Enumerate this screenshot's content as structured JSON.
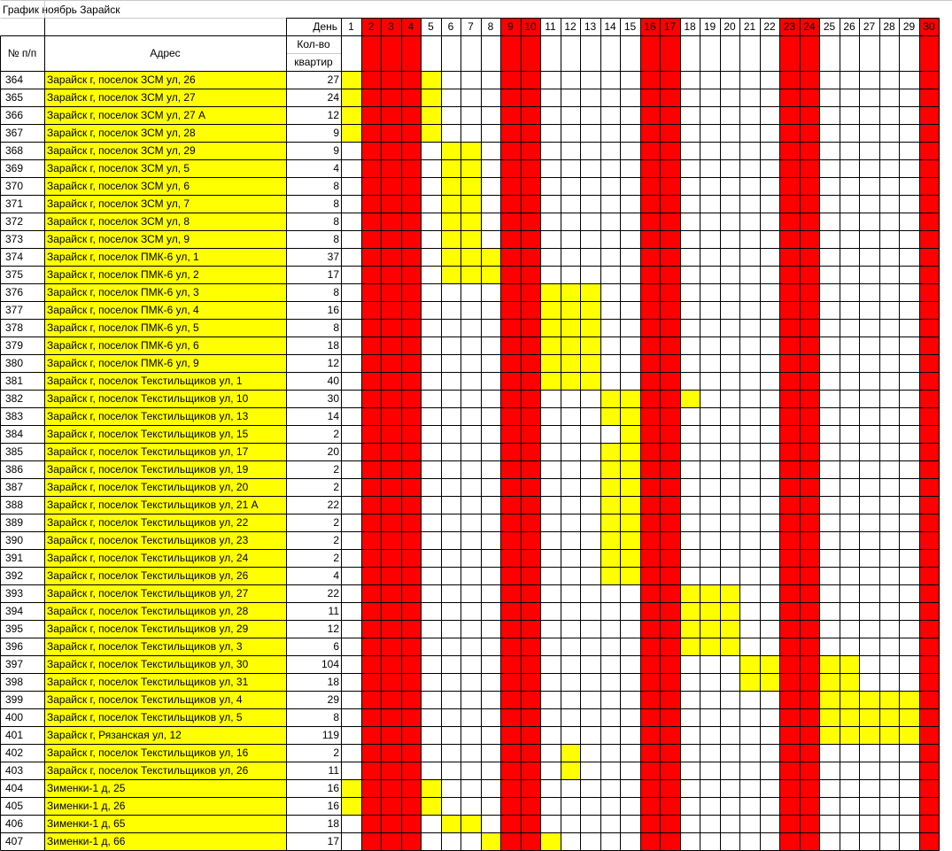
{
  "title": "График  ноябрь Зарайск",
  "header": {
    "num_label": "№ п/п",
    "address_label": "Адрес",
    "day_label": "День",
    "count_label_line1": "Кол-во",
    "count_label_line2": "квартир"
  },
  "colors": {
    "weekend": "#ff0000",
    "scheduled": "#ffff00",
    "grid": "#c8c8c8",
    "border": "#000000"
  },
  "days": [
    "1",
    "2",
    "3",
    "4",
    "5",
    "6",
    "7",
    "8",
    "9",
    "10",
    "11",
    "12",
    "13",
    "14",
    "15",
    "16",
    "17",
    "18",
    "19",
    "20",
    "21",
    "22",
    "23",
    "24",
    "25",
    "26",
    "27",
    "28",
    "29",
    "30"
  ],
  "weekend_days": [
    2,
    3,
    4,
    9,
    10,
    16,
    17,
    23,
    24,
    30
  ],
  "rows": [
    {
      "num": "364",
      "address": "Зарайск г, поселок ЗСМ ул, 26",
      "count": "27",
      "days": [
        1,
        5
      ]
    },
    {
      "num": "365",
      "address": "Зарайск г, поселок ЗСМ ул, 27",
      "count": "24",
      "days": [
        1,
        5
      ]
    },
    {
      "num": "366",
      "address": "Зарайск г, поселок ЗСМ ул, 27 А",
      "count": "12",
      "days": [
        1,
        5
      ]
    },
    {
      "num": "367",
      "address": "Зарайск г, поселок ЗСМ ул, 28",
      "count": "9",
      "days": [
        1,
        5
      ]
    },
    {
      "num": "368",
      "address": "Зарайск г, поселок ЗСМ ул, 29",
      "count": "9",
      "days": [
        6,
        7
      ]
    },
    {
      "num": "369",
      "address": "Зарайск г, поселок ЗСМ ул, 5",
      "count": "4",
      "days": [
        6,
        7
      ]
    },
    {
      "num": "370",
      "address": "Зарайск г, поселок ЗСМ ул, 6",
      "count": "8",
      "days": [
        6,
        7
      ]
    },
    {
      "num": "371",
      "address": "Зарайск г, поселок ЗСМ ул, 7",
      "count": "8",
      "days": [
        6,
        7
      ]
    },
    {
      "num": "372",
      "address": "Зарайск г, поселок ЗСМ ул, 8",
      "count": "8",
      "days": [
        6,
        7
      ]
    },
    {
      "num": "373",
      "address": "Зарайск г, поселок ЗСМ ул, 9",
      "count": "8",
      "days": [
        6,
        7
      ]
    },
    {
      "num": "374",
      "address": "Зарайск г, поселок ПМК-6 ул, 1",
      "count": "37",
      "days": [
        6,
        7,
        8
      ]
    },
    {
      "num": "375",
      "address": "Зарайск г, поселок ПМК-6 ул, 2",
      "count": "17",
      "days": [
        6,
        7,
        8
      ]
    },
    {
      "num": "376",
      "address": "Зарайск г, поселок ПМК-6 ул, 3",
      "count": "8",
      "days": [
        11,
        12,
        13
      ]
    },
    {
      "num": "377",
      "address": "Зарайск г, поселок ПМК-6 ул, 4",
      "count": "16",
      "days": [
        11,
        12,
        13
      ]
    },
    {
      "num": "378",
      "address": "Зарайск г, поселок ПМК-6 ул, 5",
      "count": "8",
      "days": [
        11,
        12,
        13
      ]
    },
    {
      "num": "379",
      "address": "Зарайск г, поселок ПМК-6 ул, 6",
      "count": "18",
      "days": [
        11,
        12,
        13
      ]
    },
    {
      "num": "380",
      "address": "Зарайск г, поселок ПМК-6 ул, 9",
      "count": "12",
      "days": [
        11,
        12,
        13
      ]
    },
    {
      "num": "381",
      "address": "Зарайск г, поселок Текстильщиков ул, 1",
      "count": "40",
      "days": [
        11,
        12,
        13
      ]
    },
    {
      "num": "382",
      "address": "Зарайск г, поселок Текстильщиков ул, 10",
      "count": "30",
      "days": [
        14,
        15,
        18
      ]
    },
    {
      "num": "383",
      "address": "Зарайск г, поселок Текстильщиков ул, 13",
      "count": "14",
      "days": [
        14,
        15
      ]
    },
    {
      "num": "384",
      "address": "Зарайск г, поселок Текстильщиков ул, 15",
      "count": "2",
      "days": [
        15
      ]
    },
    {
      "num": "385",
      "address": "Зарайск г, поселок Текстильщиков ул, 17",
      "count": "20",
      "days": [
        14,
        15
      ]
    },
    {
      "num": "386",
      "address": "Зарайск г, поселок Текстильщиков ул, 19",
      "count": "2",
      "days": [
        14,
        15
      ]
    },
    {
      "num": "387",
      "address": "Зарайск г, поселок Текстильщиков ул, 20",
      "count": "2",
      "days": [
        14,
        15
      ]
    },
    {
      "num": "388",
      "address": "Зарайск г, поселок Текстильщиков ул, 21 А",
      "count": "22",
      "days": [
        14,
        15
      ]
    },
    {
      "num": "389",
      "address": "Зарайск г, поселок Текстильщиков ул, 22",
      "count": "2",
      "days": [
        14,
        15
      ]
    },
    {
      "num": "390",
      "address": "Зарайск г, поселок Текстильщиков ул, 23",
      "count": "2",
      "days": [
        14,
        15
      ]
    },
    {
      "num": "391",
      "address": "Зарайск г, поселок Текстильщиков ул, 24",
      "count": "2",
      "days": [
        14,
        15
      ]
    },
    {
      "num": "392",
      "address": "Зарайск г, поселок Текстильщиков ул, 26",
      "count": "4",
      "days": [
        14,
        15
      ]
    },
    {
      "num": "393",
      "address": "Зарайск г, поселок Текстильщиков ул, 27",
      "count": "22",
      "days": [
        18,
        19,
        20
      ]
    },
    {
      "num": "394",
      "address": "Зарайск г, поселок Текстильщиков ул, 28",
      "count": "11",
      "days": [
        18,
        19,
        20
      ]
    },
    {
      "num": "395",
      "address": "Зарайск г, поселок Текстильщиков ул, 29",
      "count": "12",
      "days": [
        18,
        19,
        20
      ]
    },
    {
      "num": "396",
      "address": "Зарайск г, поселок Текстильщиков ул, 3",
      "count": "6",
      "days": [
        18,
        19,
        20
      ]
    },
    {
      "num": "397",
      "address": "Зарайск г, поселок Текстильщиков ул, 30",
      "count": "104",
      "days": [
        21,
        22,
        25,
        26
      ]
    },
    {
      "num": "398",
      "address": "Зарайск г, поселок Текстильщиков ул, 31",
      "count": "18",
      "days": [
        21,
        22,
        25,
        26
      ]
    },
    {
      "num": "399",
      "address": "Зарайск г, поселок Текстильщиков ул, 4",
      "count": "29",
      "days": [
        25,
        26,
        27,
        28,
        29
      ]
    },
    {
      "num": "400",
      "address": "Зарайск г, поселок Текстильщиков ул, 5",
      "count": "8",
      "days": [
        25,
        26,
        27,
        28,
        29
      ]
    },
    {
      "num": "401",
      "address": "Зарайск г, Рязанская ул, 12",
      "count": "119",
      "days": [
        25,
        26,
        27,
        28,
        29
      ]
    },
    {
      "num": "402",
      "address": "Зарайск г, поселок Текстильщиков ул, 16",
      "count": "2",
      "days": [
        12
      ]
    },
    {
      "num": "403",
      "address": "Зарайск г, поселок Текстильщиков ул, 26",
      "count": "11",
      "days": [
        12
      ]
    },
    {
      "num": "404",
      "address": "Зименки-1 д, 25",
      "count": "16",
      "days": [
        1,
        5
      ]
    },
    {
      "num": "405",
      "address": "Зименки-1 д, 26",
      "count": "16",
      "days": [
        1,
        5
      ]
    },
    {
      "num": "406",
      "address": "Зименки-1 д, 65",
      "count": "18",
      "days": [
        6,
        7
      ]
    },
    {
      "num": "407",
      "address": "Зименки-1 д, 66",
      "count": "17",
      "days": [
        8,
        11
      ]
    }
  ]
}
